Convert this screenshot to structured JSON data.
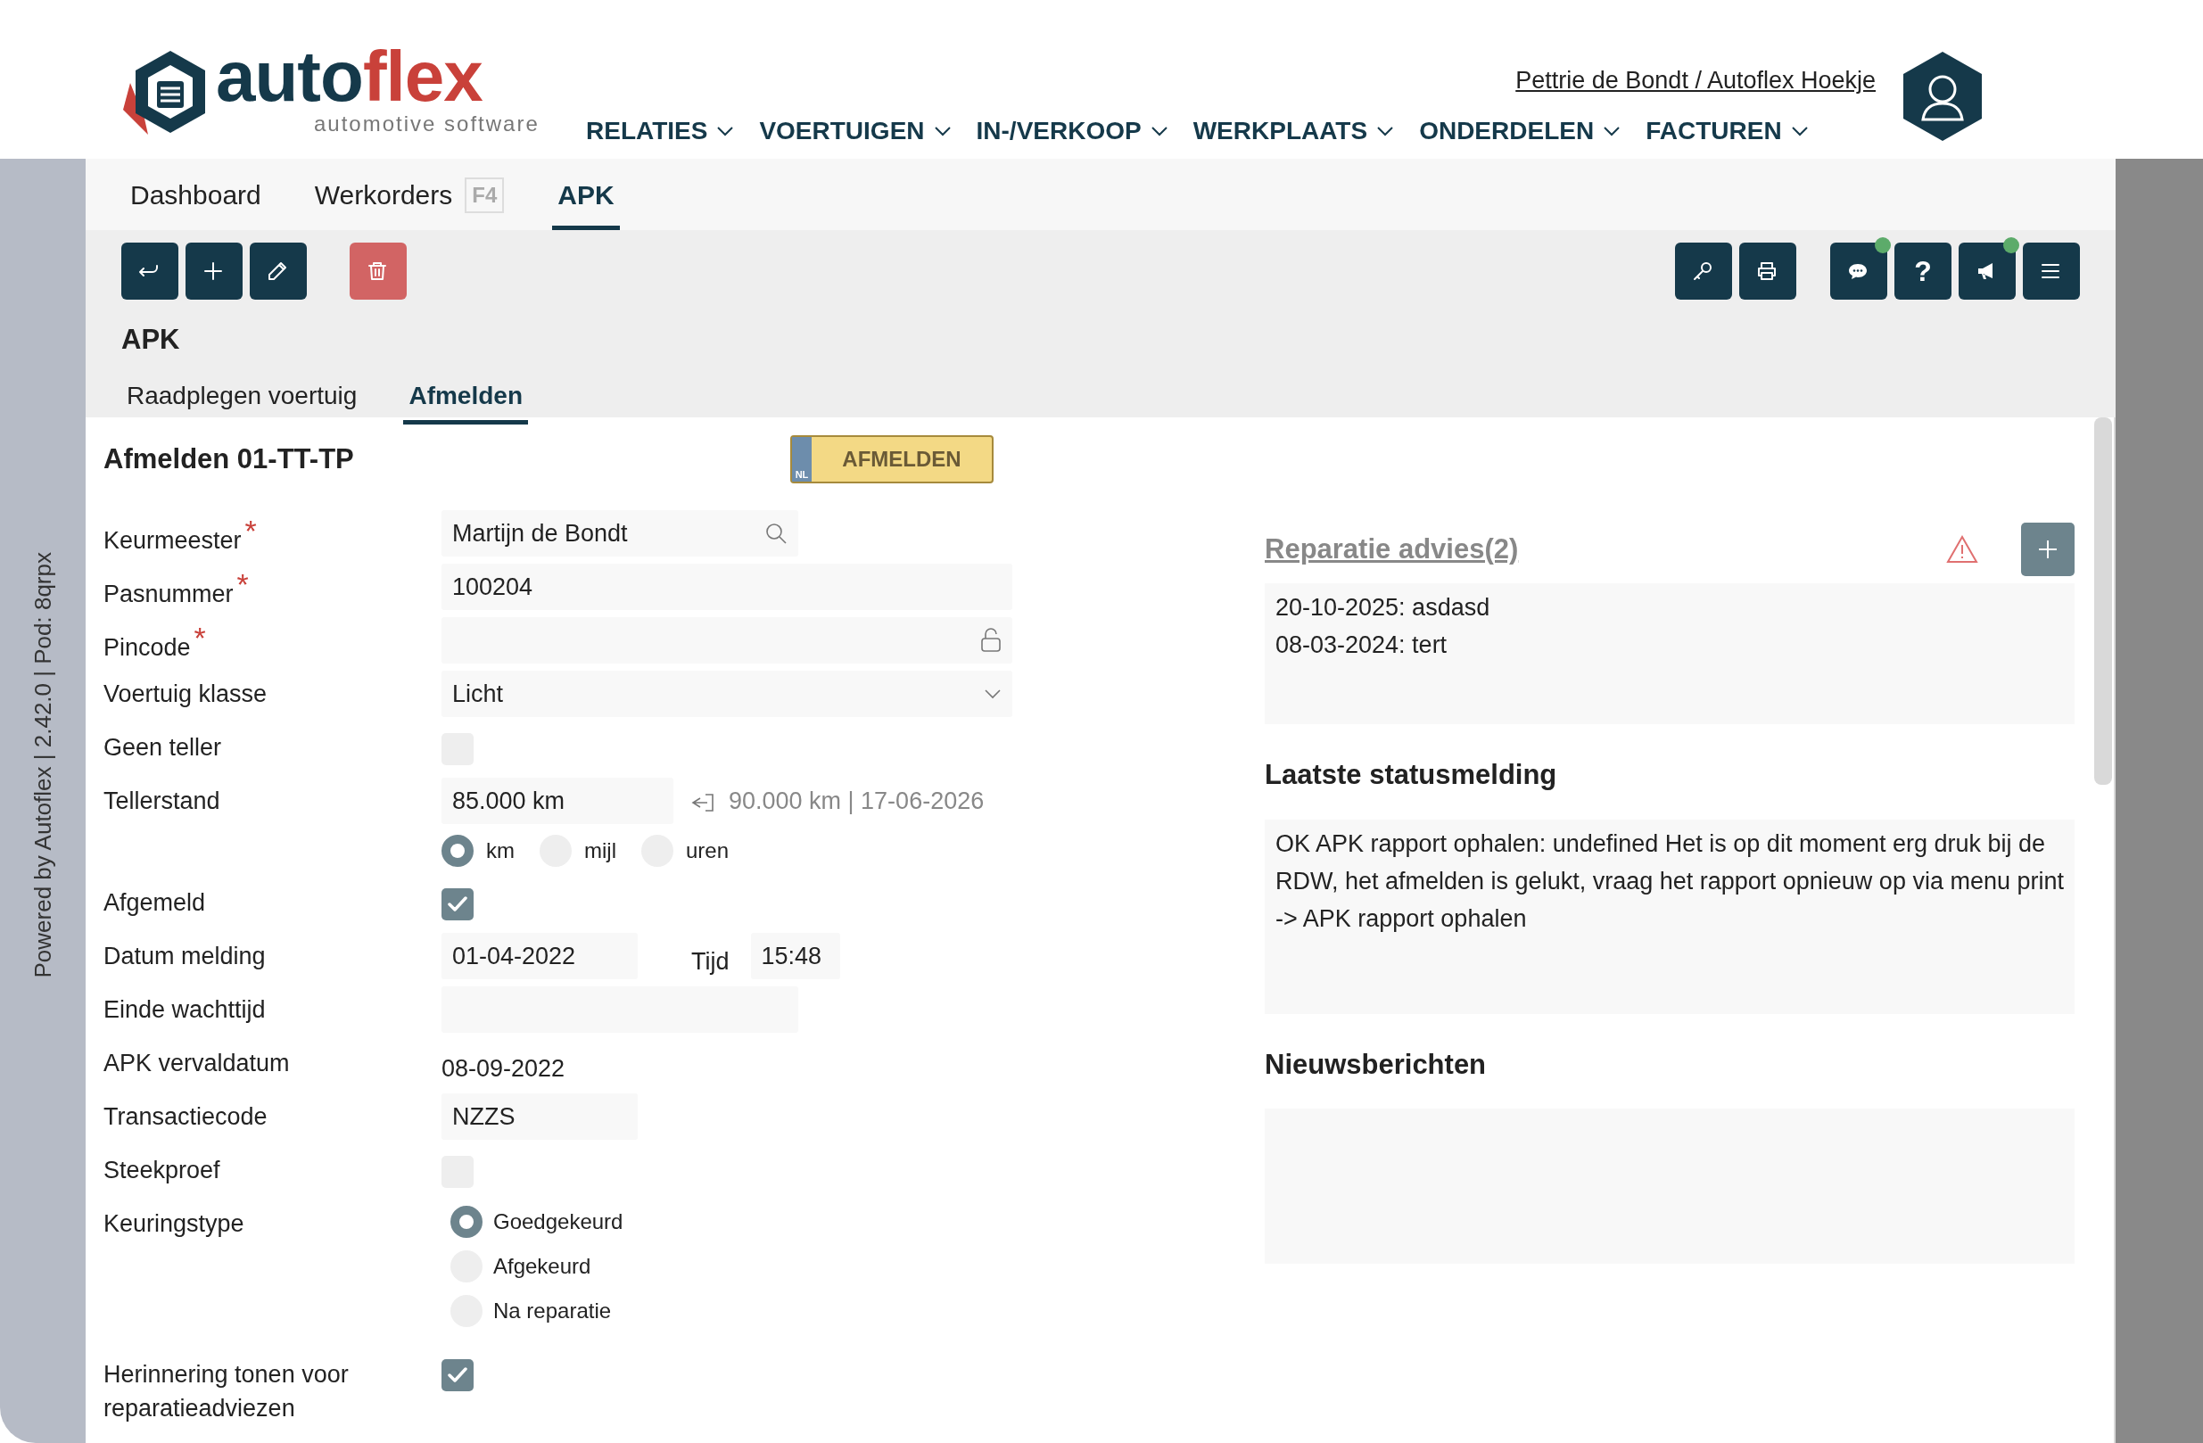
{
  "brand": {
    "wordmark_parts": [
      "auto",
      "flex"
    ],
    "tagline": "automotive software"
  },
  "user_link": "Pettrie de Bondt / Autoflex Hoekje",
  "nav": [
    {
      "label": "RELATIES"
    },
    {
      "label": "VOERTUIGEN"
    },
    {
      "label": "IN-/VERKOOP"
    },
    {
      "label": "WERKPLAATS"
    },
    {
      "label": "ONDERDELEN"
    },
    {
      "label": "FACTUREN"
    }
  ],
  "side_note": "Powered by Autoflex | 2.42.0 | Pod: 8qrpx",
  "tabs": [
    {
      "label": "Dashboard",
      "selected": false
    },
    {
      "label": "Werkorders",
      "shortcut": "F4",
      "selected": false
    },
    {
      "label": "APK",
      "selected": true
    }
  ],
  "toolbar_left": [
    {
      "kind": "back"
    },
    {
      "kind": "add"
    },
    {
      "kind": "edit"
    },
    {
      "kind": "delete"
    }
  ],
  "toolbar_right": [
    {
      "kind": "key",
      "notification": false
    },
    {
      "kind": "print",
      "notification": false
    },
    {
      "kind": "chat",
      "notification": true
    },
    {
      "kind": "help",
      "label": "?",
      "notification": false
    },
    {
      "kind": "announce",
      "notification": true
    },
    {
      "kind": "menu",
      "notification": false
    }
  ],
  "page_title": "APK",
  "subtabs": [
    {
      "label": "Raadplegen voertuig",
      "selected": false
    },
    {
      "label": "Afmelden",
      "selected": true
    }
  ],
  "form": {
    "title": "Afmelden 01-TT-TP",
    "plate_button": {
      "country": "NL",
      "label": "AFMELDEN"
    },
    "fields": [
      {
        "kind": "search",
        "label": "Keurmeester",
        "marker": "*",
        "value": "Martijn de Bondt"
      },
      {
        "kind": "text",
        "label": "Pasnummer",
        "marker": "*",
        "value": "100204"
      },
      {
        "kind": "lock",
        "label": "Pincode",
        "marker": "*"
      },
      {
        "kind": "select",
        "label": "Voertuig klasse",
        "value": "Licht"
      },
      {
        "kind": "checkbox",
        "label": "Geen teller",
        "checked": false
      },
      {
        "kind": "odometer",
        "label": "Tellerstand",
        "value": "85.000 km",
        "hint": "90.000 km | 17-06-2026",
        "units": [
          {
            "label": "km",
            "selected": true
          },
          {
            "label": "mijl",
            "selected": false
          },
          {
            "label": "uren",
            "selected": false
          }
        ]
      },
      {
        "kind": "checkbox",
        "label": "Afgemeld",
        "checked": true
      },
      {
        "kind": "datetime",
        "label": "Datum melding",
        "value": "01-04-2022",
        "time_label": "Tijd",
        "time": "15:48"
      },
      {
        "kind": "text",
        "label": "Einde wachttijd"
      },
      {
        "kind": "static",
        "label": "APK vervaldatum",
        "value": "08-09-2022"
      },
      {
        "kind": "text",
        "label": "Transactiecode",
        "value": "NZZS"
      },
      {
        "kind": "checkbox",
        "label": "Steekproef",
        "checked": false
      },
      {
        "kind": "radios",
        "label": "Keuringstype",
        "options": [
          {
            "label": "Goedgekeurd",
            "selected": true
          },
          {
            "label": "Afgekeurd",
            "selected": false
          },
          {
            "label": "Na reparatie",
            "selected": false
          }
        ]
      },
      {
        "kind": "checkbox",
        "label": "Herinnering tonen voor reparatieadviezen",
        "checked": true
      }
    ]
  },
  "repair": {
    "title": "Reparatie advies(2)",
    "entries": [
      "20-10-2025: asdasd",
      "08-03-2024: tert"
    ]
  },
  "status": {
    "title": "Laatste statusmelding",
    "text": "OK APK rapport ophalen: undefined Het is op dit moment erg druk bij de RDW, het afmelden is gelukt, vraag het rapport opnieuw op via menu print -> APK rapport ophalen"
  },
  "news": {
    "title": "Nieuwsberichten"
  }
}
